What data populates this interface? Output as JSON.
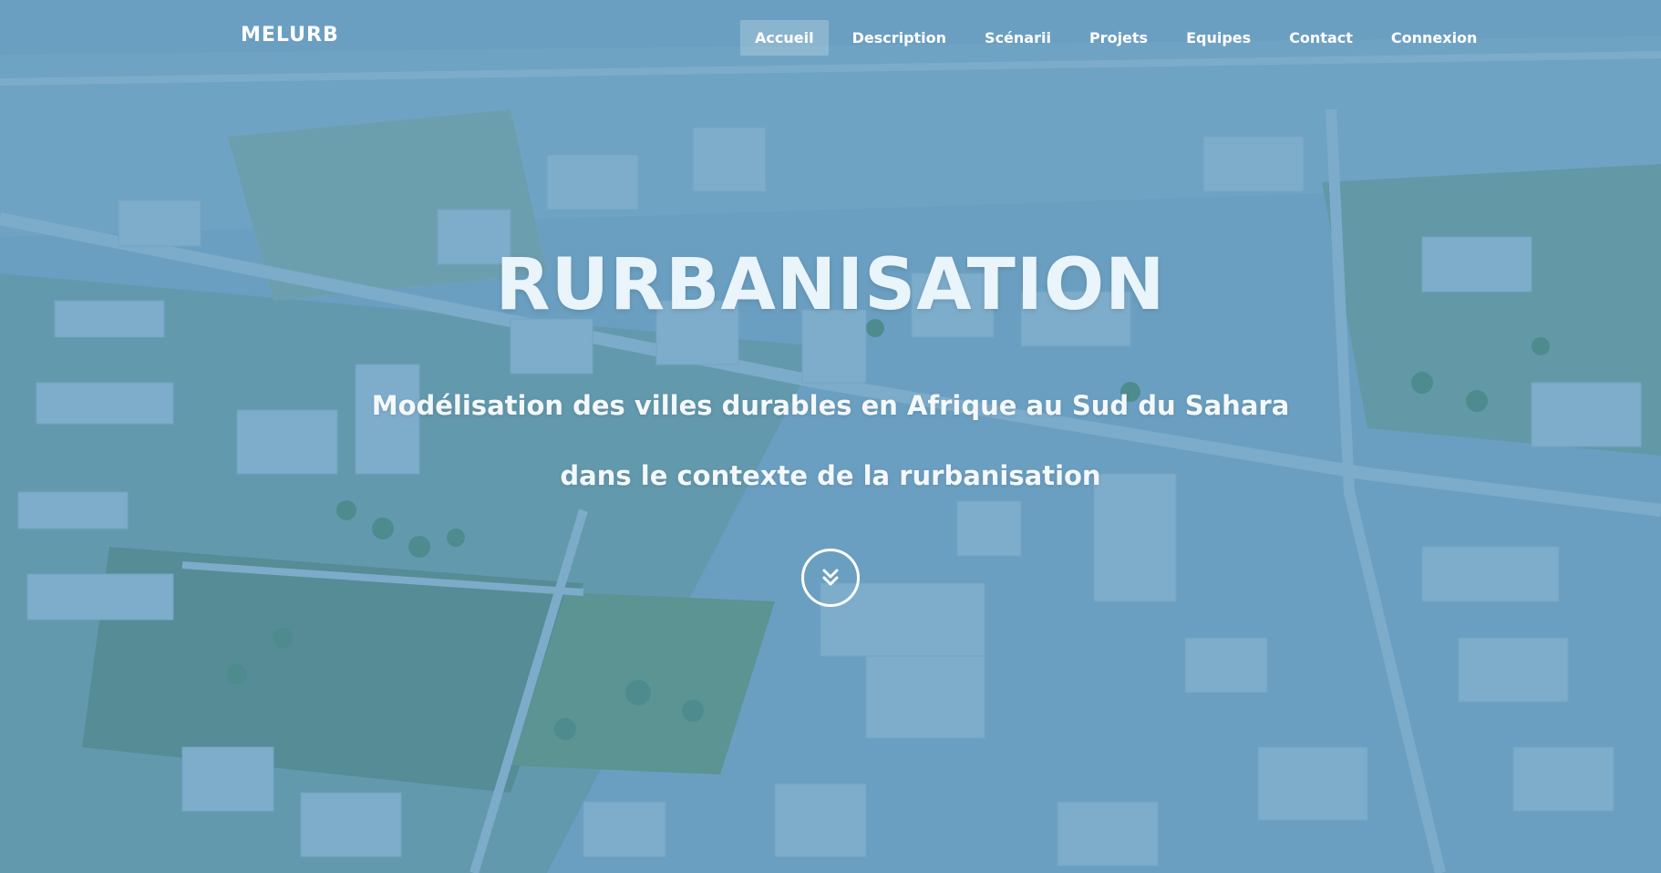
{
  "brand": "MELURB",
  "nav": {
    "items": [
      {
        "label": "Accueil",
        "active": true
      },
      {
        "label": "Description",
        "active": false
      },
      {
        "label": "Scénarii",
        "active": false
      },
      {
        "label": "Projets",
        "active": false
      },
      {
        "label": "Equipes",
        "active": false
      },
      {
        "label": "Contact",
        "active": false
      },
      {
        "label": "Connexion",
        "active": false
      }
    ]
  },
  "hero": {
    "title": "RURBANISATION",
    "subtitle_line1": "Modélisation des villes durables en Afrique au Sud du Sahara",
    "subtitle_line2": "dans le contexte de la rurbanisation",
    "scroll_icon": "double-chevron-down-icon"
  },
  "colors": {
    "overlay": "#408cbe",
    "text": "#ffffff",
    "active_nav_bg": "#ffffff38"
  }
}
